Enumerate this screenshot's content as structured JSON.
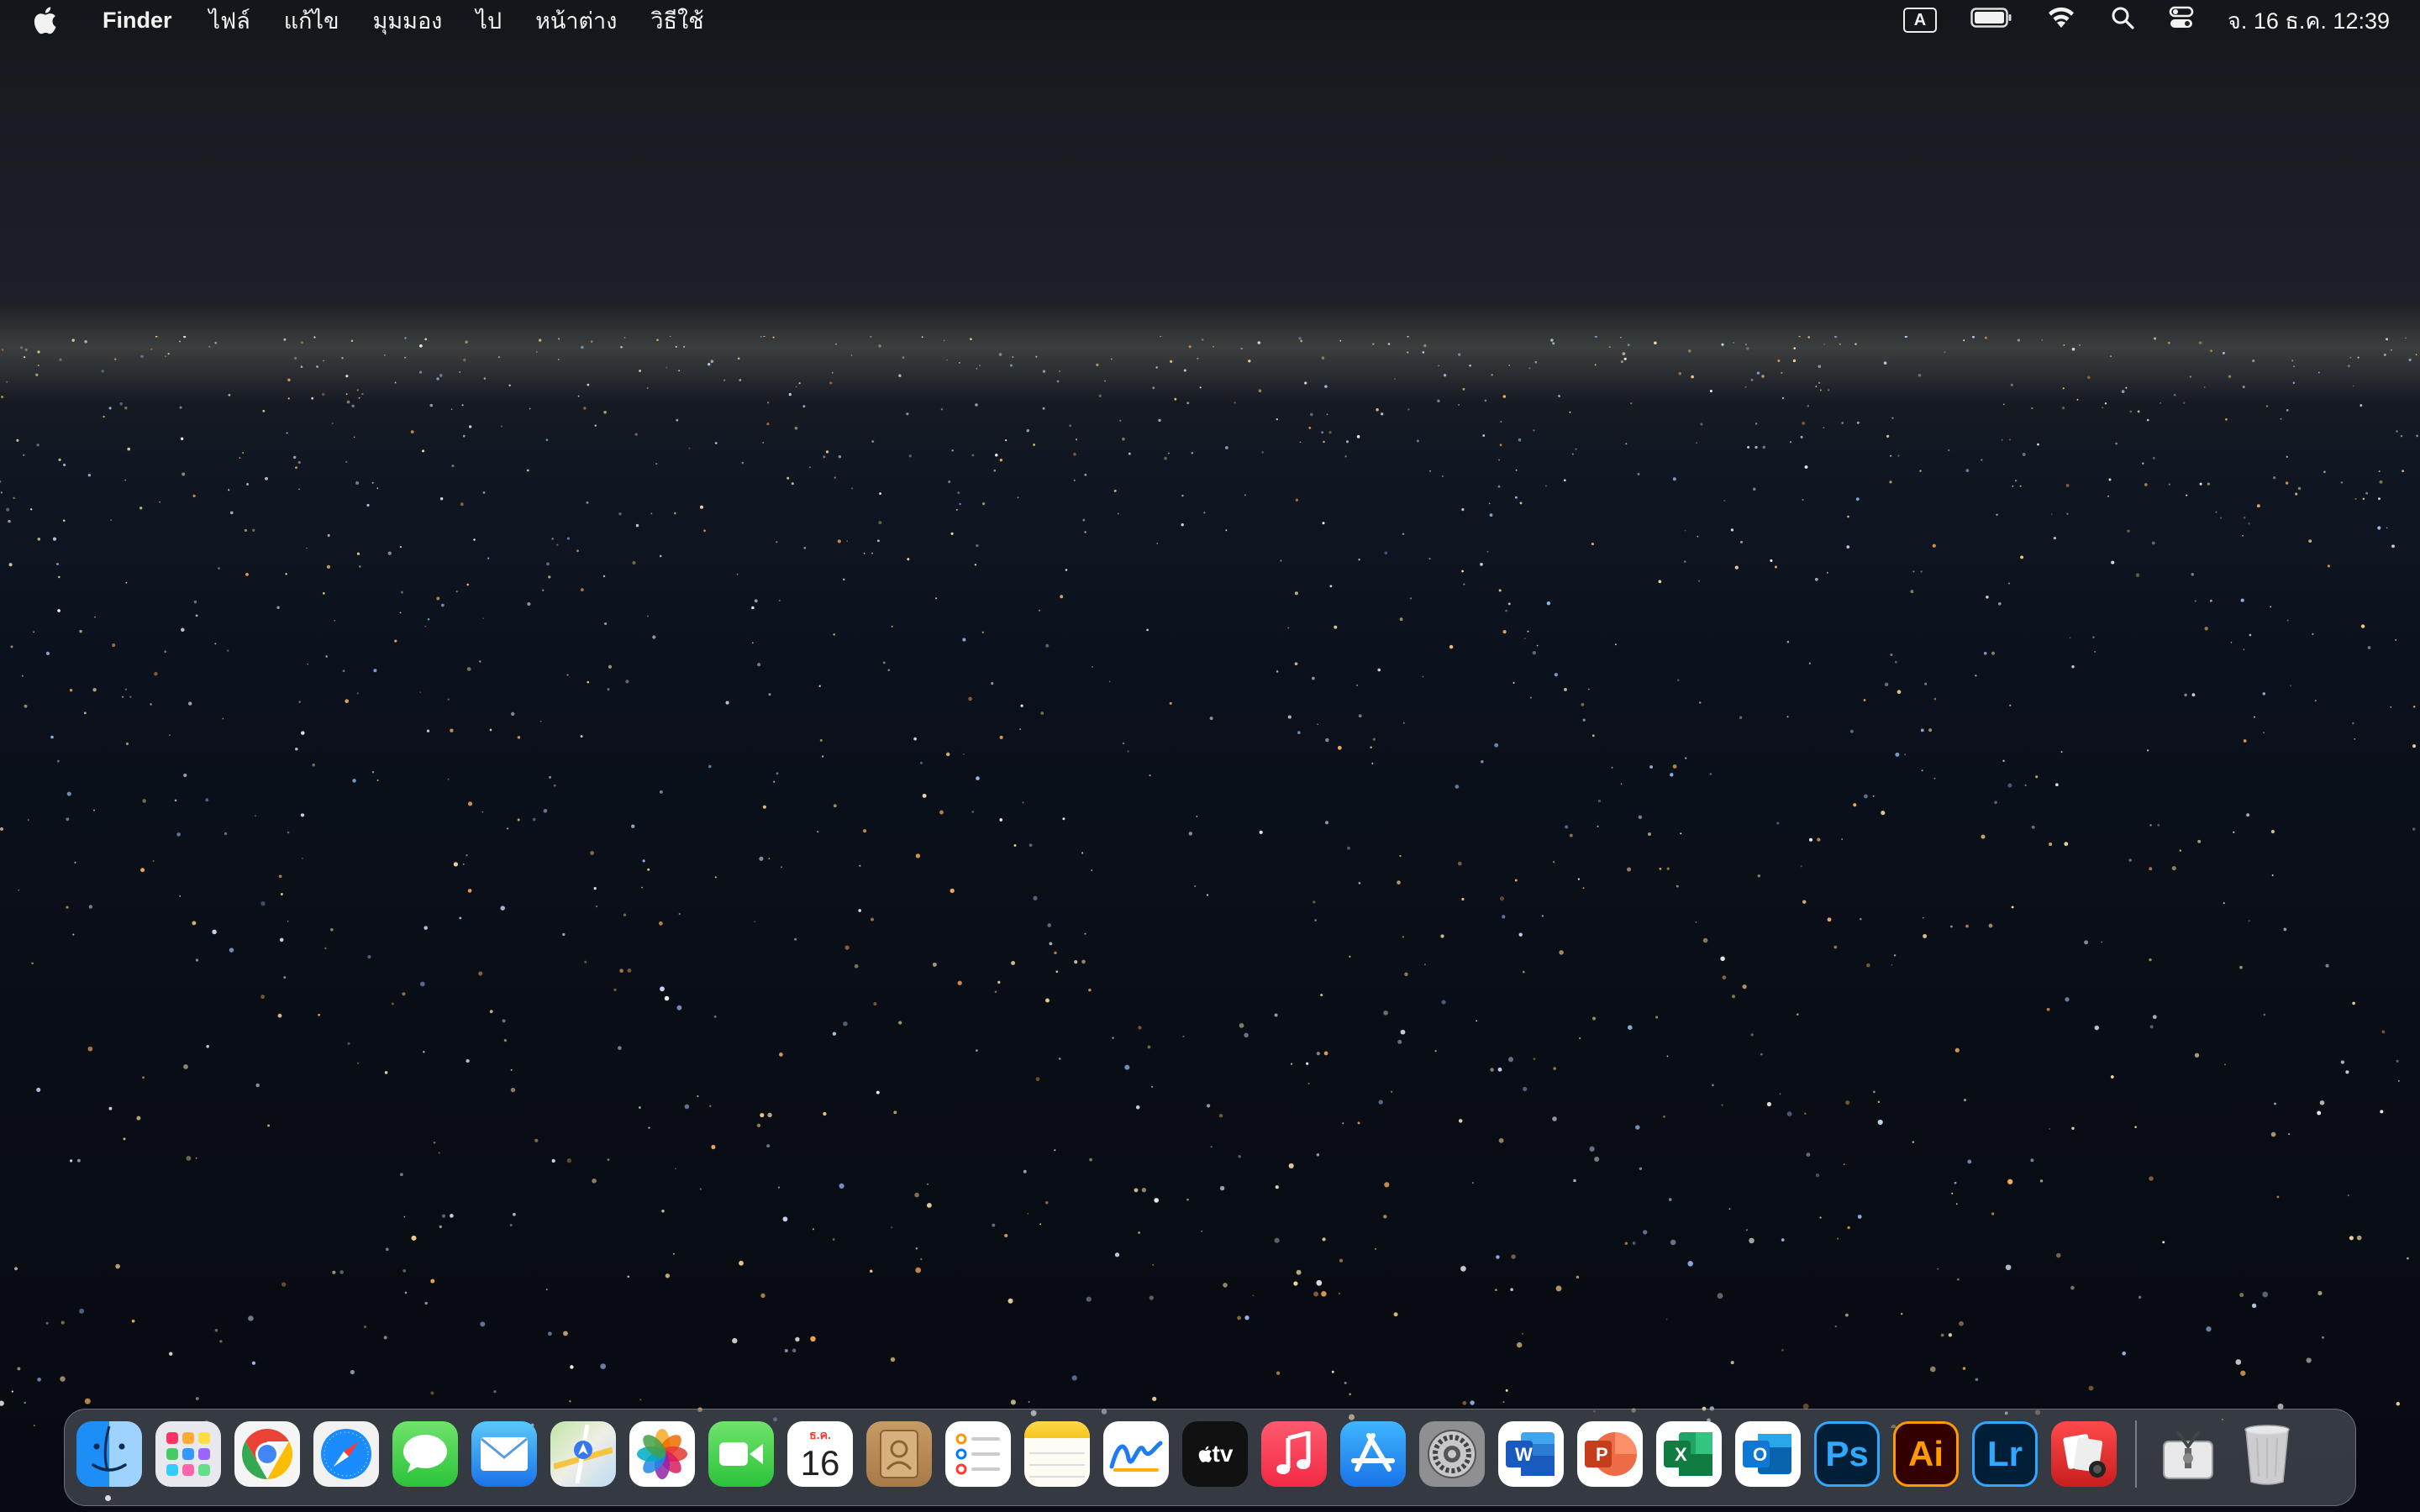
{
  "menubar": {
    "app_name": "Finder",
    "items": [
      "ไฟล์",
      "แก้ไข",
      "มุมมอง",
      "ไป",
      "หน้าต่าง",
      "วิธีใช้"
    ],
    "input_source": "A",
    "clock": "จ. 16 ธ.ค.  12:39"
  },
  "dock": {
    "calendar_month": "ธ.ค.",
    "calendar_day": "16",
    "tv_label": "tv",
    "ps_label": "Ps",
    "ai_label": "Ai",
    "lr_label": "Lr",
    "word_label": "W",
    "ppt_label": "P",
    "excel_label": "X",
    "outlook_label": "O",
    "apps": [
      "finder-icon",
      "launchpad-icon",
      "chrome-icon",
      "safari-icon",
      "messages-icon",
      "mail-icon",
      "maps-icon",
      "photos-icon",
      "facetime-icon",
      "calendar-icon",
      "contacts-icon",
      "reminders-icon",
      "notes-icon",
      "freeform-icon",
      "apple-tv-icon",
      "music-icon",
      "app-store-icon",
      "system-settings-icon",
      "word-icon",
      "powerpoint-icon",
      "excel-icon",
      "outlook-icon",
      "photoshop-icon",
      "illustrator-icon",
      "lightroom-icon",
      "photo-booth-icon",
      "archive-utility-icon",
      "trash-icon"
    ]
  },
  "colors": {
    "menubar_text": "#f2f2f2",
    "ps_blue": "#31a8ff",
    "ai_orange": "#ff9a00",
    "lr_blue": "#31a8ff"
  }
}
